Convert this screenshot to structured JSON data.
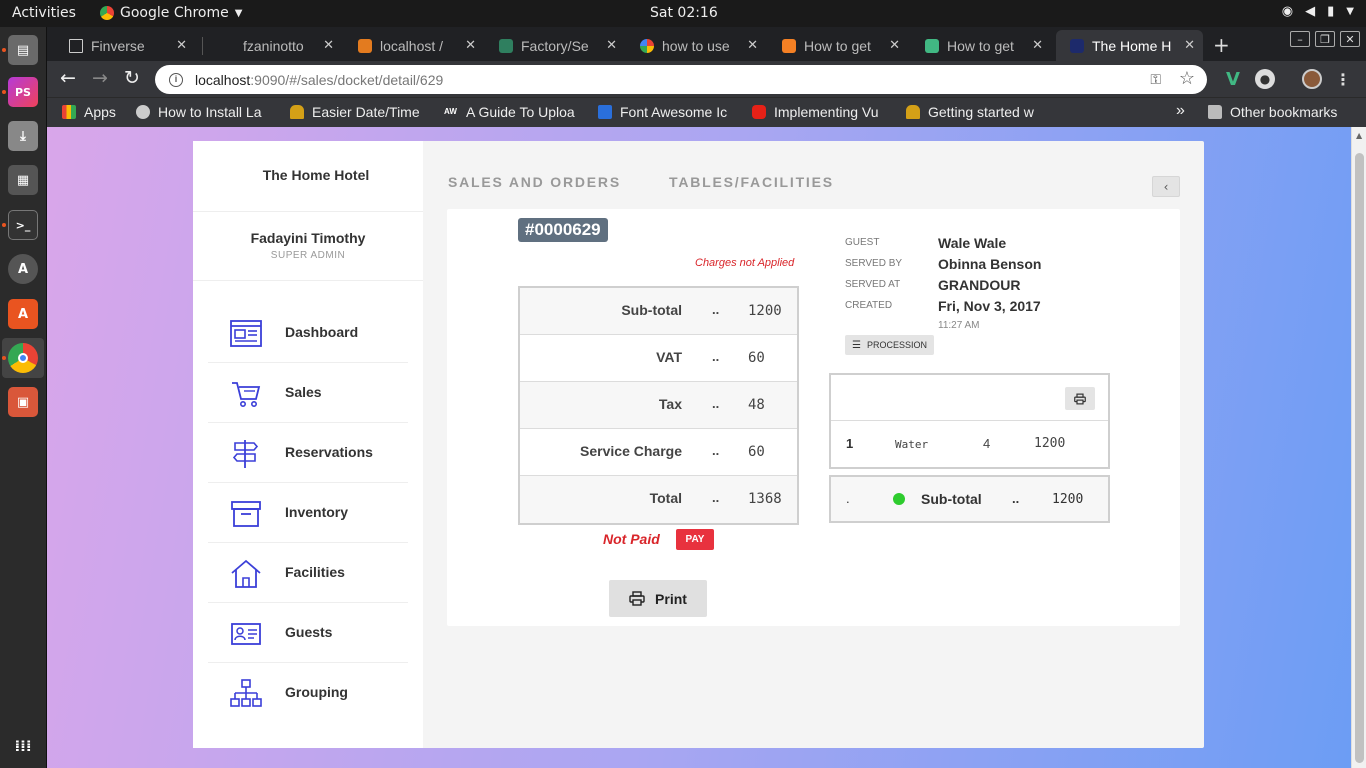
{
  "os": {
    "activities": "Activities",
    "app_menu": "Google Chrome",
    "clock": "Sat 02:16"
  },
  "browser": {
    "tabs": [
      {
        "title": "Finverse",
        "active": false
      },
      {
        "title": "fzaninotto",
        "active": false
      },
      {
        "title": "localhost /",
        "active": false
      },
      {
        "title": "Factory/Se",
        "active": false
      },
      {
        "title": "how to use",
        "active": false
      },
      {
        "title": "How to get",
        "active": false
      },
      {
        "title": "How to get",
        "active": false
      },
      {
        "title": "The Home H",
        "active": true
      }
    ],
    "url_host": "localhost",
    "url_path": ":9090/#/sales/docket/detail/629",
    "bookmarks": [
      "Apps",
      "How to Install La",
      "Easier Date/Time",
      "A Guide To Uploa",
      "Font Awesome Ic",
      "Implementing Vu",
      "Getting started w"
    ],
    "bookmarks_overflow": "»",
    "other_bookmarks": "Other bookmarks"
  },
  "sidebar": {
    "hotel_name": "The Home Hotel",
    "user_name": "Fadayini Timothy",
    "user_role": "SUPER ADMIN",
    "nav": [
      {
        "label": "Dashboard",
        "icon": "dashboard-icon"
      },
      {
        "label": "Sales",
        "icon": "cart-icon"
      },
      {
        "label": "Reservations",
        "icon": "signpost-icon"
      },
      {
        "label": "Inventory",
        "icon": "archive-box-icon"
      },
      {
        "label": "Facilities",
        "icon": "home-icon"
      },
      {
        "label": "Guests",
        "icon": "id-card-icon"
      },
      {
        "label": "Grouping",
        "icon": "hierarchy-icon"
      }
    ]
  },
  "main": {
    "tabs": [
      "SALES AND ORDERS",
      "TABLES/FACILITIES"
    ],
    "collapse": "‹"
  },
  "docket": {
    "number": "#0000629",
    "charges_note": "Charges not Applied",
    "totals": [
      {
        "label": "Sub-total",
        "dots": "..",
        "value": "1200"
      },
      {
        "label": "VAT",
        "dots": "..",
        "value": "60"
      },
      {
        "label": "Tax",
        "dots": "..",
        "value": "48"
      },
      {
        "label": "Service Charge",
        "dots": "..",
        "value": "60"
      },
      {
        "label": "Total",
        "dots": "..",
        "value": "1368"
      }
    ],
    "payment_status": "Not Paid",
    "pay_label": "PAY",
    "print_label": "Print",
    "meta": {
      "guest_label": "GUEST",
      "guest": "Wale Wale",
      "served_by_label": "SERVED BY",
      "served_by": "Obinna Benson",
      "served_at_label": "SERVED AT",
      "served_at": "GRANDOUR",
      "created_label": "CREATED",
      "created_date": "Fri, Nov 3, 2017",
      "created_time": "11:27 AM"
    },
    "procession_label": "PROCESSION",
    "items": [
      {
        "index": "1",
        "name": "Water",
        "qty": "4",
        "price": "1200"
      }
    ],
    "subtotal": {
      "marker": ".",
      "label": "Sub-total",
      "dots": "..",
      "value": "1200",
      "status_color": "#2ecc2e"
    }
  },
  "colors": {
    "accent_icon": "#3b3fd8",
    "danger": "#d9252a",
    "badge": "#607080"
  }
}
